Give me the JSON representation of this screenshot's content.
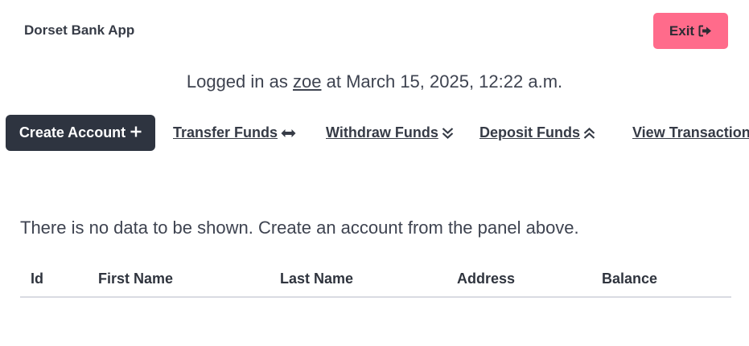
{
  "header": {
    "brand": "Dorset Bank App",
    "exit_label": "Exit"
  },
  "session": {
    "prefix": "Logged in as",
    "username": "zoe",
    "at": "at",
    "timestamp": "March 15, 2025, 12:22 a.m."
  },
  "nav": {
    "create_account": "Create Account",
    "transfer_funds": "Transfer Funds",
    "withdraw_funds": "Withdraw Funds",
    "deposit_funds": "Deposit Funds",
    "view_transactions": "View Transactions"
  },
  "main": {
    "empty_message": "There is no data to be shown. Create an account from the panel above."
  },
  "table": {
    "columns": [
      "Id",
      "First Name",
      "Last Name",
      "Address",
      "Balance"
    ],
    "rows": []
  },
  "colors": {
    "exit_button": "#ff6b8b",
    "primary_button": "#2e3440",
    "text": "#363b46",
    "divider": "#d9dbe2"
  },
  "icons": {
    "exit": "sign-out-icon",
    "create": "plus-icon",
    "transfer": "arrows-left-right-icon",
    "withdraw": "double-chevron-down-icon",
    "deposit": "double-chevron-up-icon"
  }
}
